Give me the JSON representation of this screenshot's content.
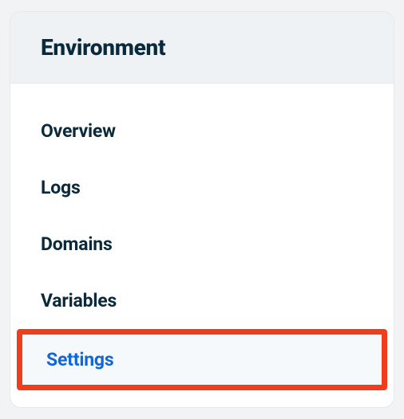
{
  "panel": {
    "title": "Environment"
  },
  "nav": {
    "items": [
      {
        "label": "Overview"
      },
      {
        "label": "Logs"
      },
      {
        "label": "Domains"
      },
      {
        "label": "Variables"
      },
      {
        "label": "Settings"
      }
    ]
  }
}
